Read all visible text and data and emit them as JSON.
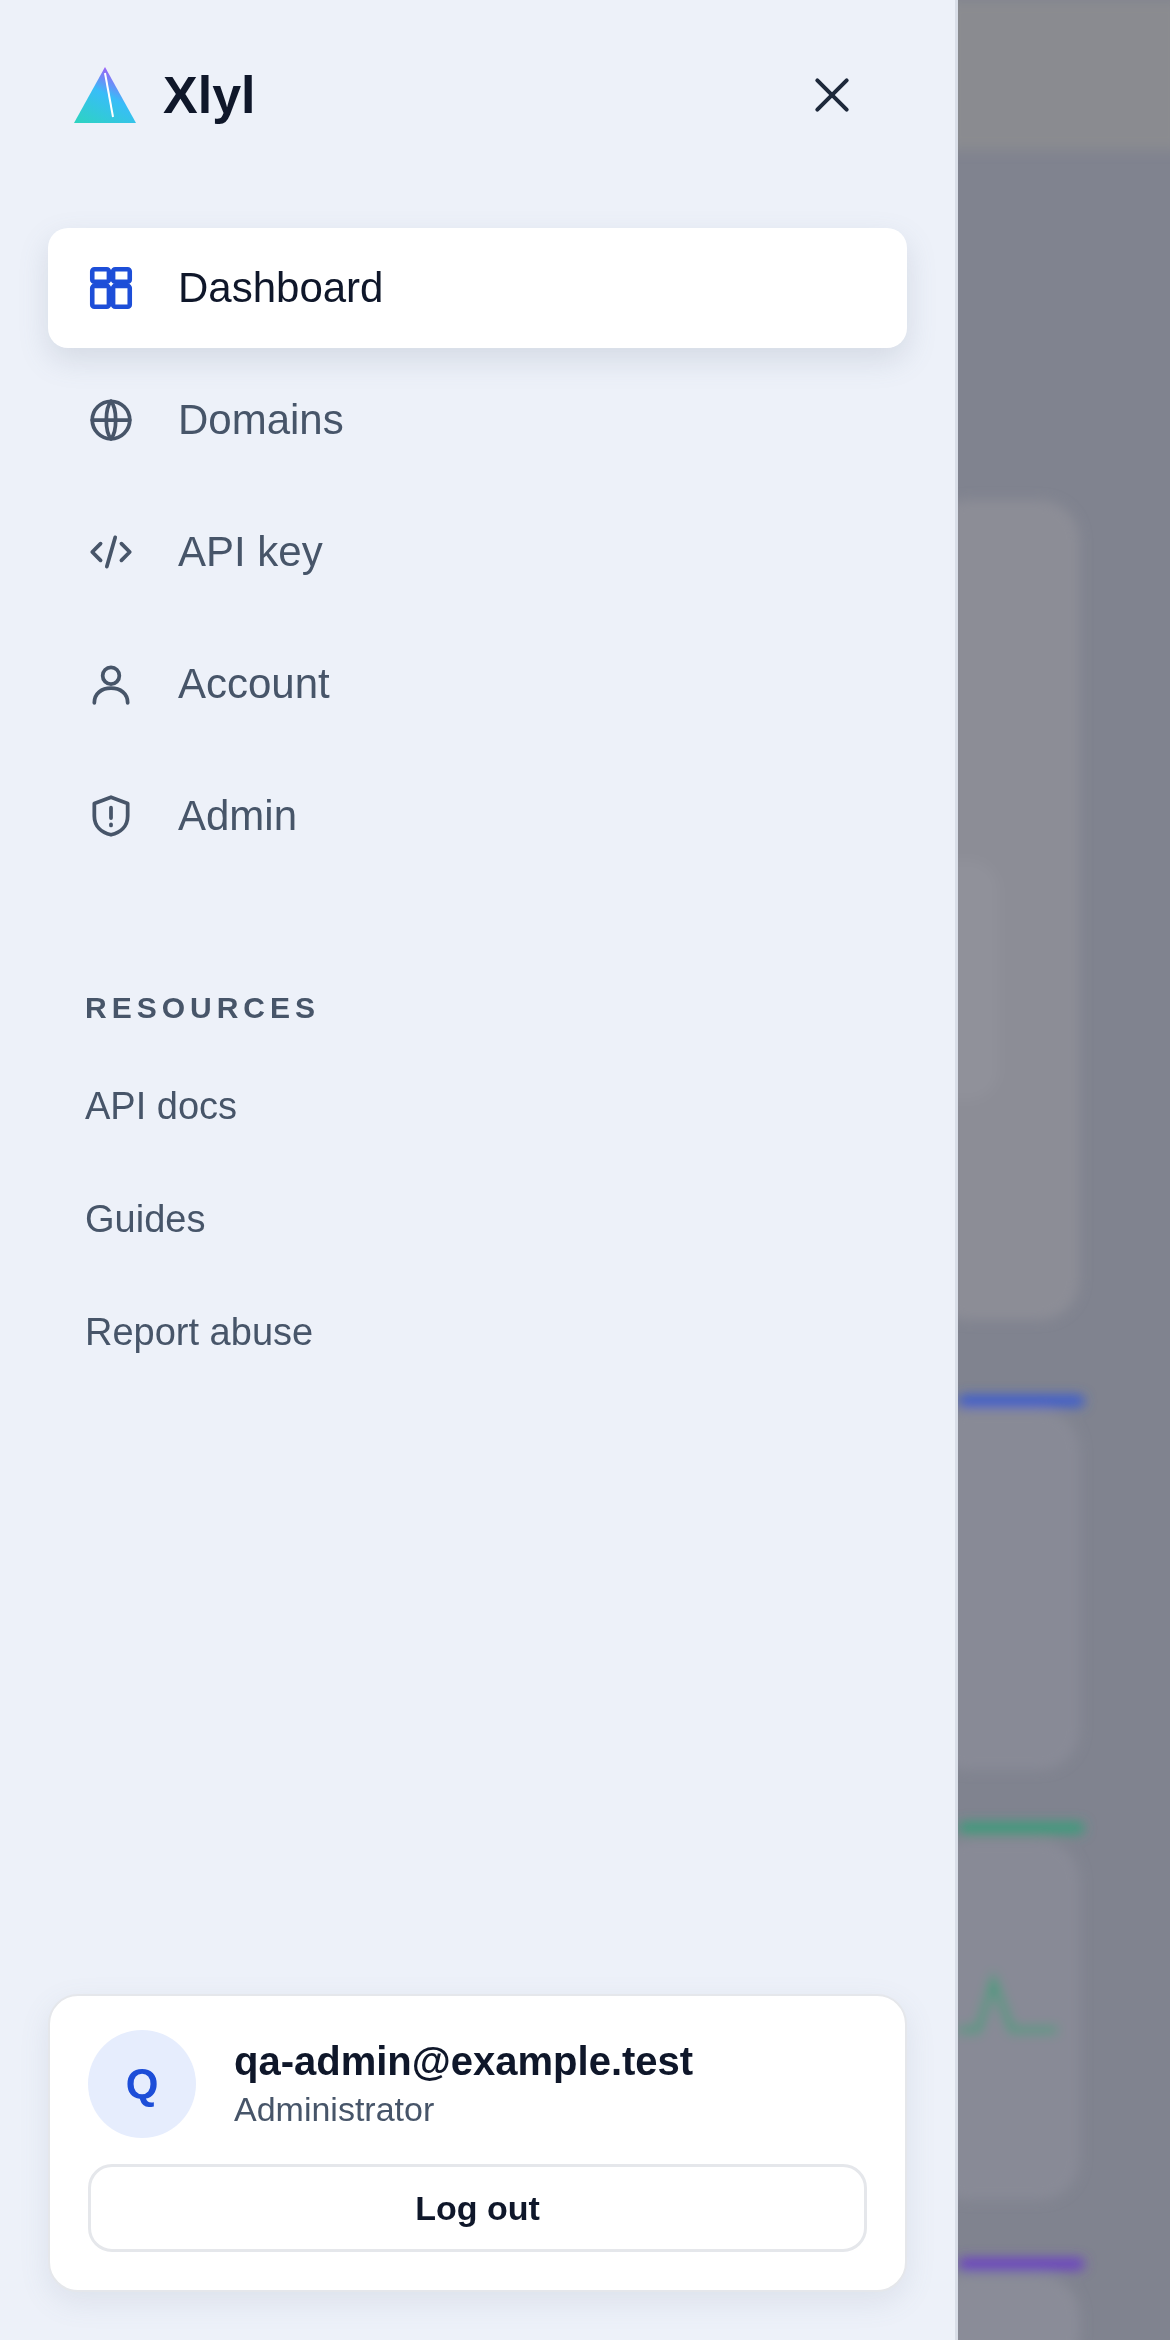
{
  "brand": {
    "name": "Xlyl"
  },
  "nav": [
    {
      "label": "Dashboard",
      "selected": true
    },
    {
      "label": "Domains",
      "selected": false
    },
    {
      "label": "API key",
      "selected": false
    },
    {
      "label": "Account",
      "selected": false
    },
    {
      "label": "Admin",
      "selected": false
    }
  ],
  "resources": {
    "heading": "RESOURCES",
    "links": [
      "API docs",
      "Guides",
      "Report abuse"
    ]
  },
  "user": {
    "initial": "Q",
    "email": "qa-admin@example.test",
    "role": "Administrator",
    "logout": "Log out"
  }
}
